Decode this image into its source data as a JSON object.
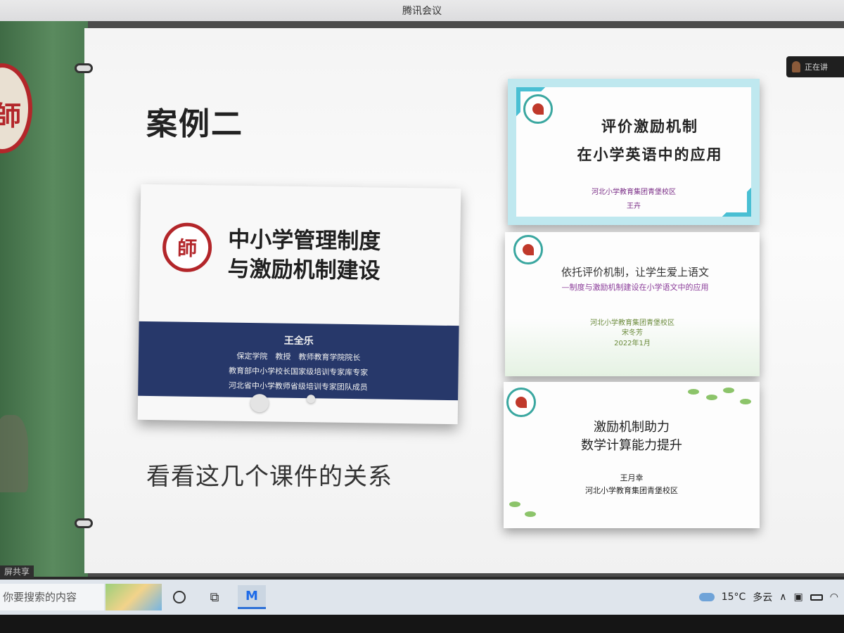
{
  "window": {
    "title": "腾讯会议"
  },
  "presenter": {
    "label": "正在讲"
  },
  "share": {
    "label": "屏共享"
  },
  "left_strip": {
    "seal_char": "師"
  },
  "slide": {
    "title": "案例二",
    "caption": "看看这几个课件的关系",
    "main_card": {
      "logo_char": "師",
      "headline_line1": "中小学管理制度",
      "headline_line2": "与激励机制建设",
      "name": "王全乐",
      "line1": "保定学院　教授　教师教育学院院长",
      "line2": "教育部中小学校长国家级培训专家库专家",
      "line3": "河北省中小学教师省级培训专家团队成员"
    },
    "thumb1": {
      "title_line1": "评价激励机制",
      "title_line2": "在小学英语中的应用",
      "org": "河北小学教育集团青堡校区",
      "person": "王卉"
    },
    "thumb2": {
      "title": "依托评价机制，让学生爱上语文",
      "subtitle": "—制度与激励机制建设在小学语文中的应用",
      "org": "河北小学教育集团青堡校区",
      "person": "宋冬芳",
      "date": "2022年1月"
    },
    "thumb3": {
      "title_line1": "激励机制助力",
      "title_line2": "数学计算能力提升",
      "person": "王月幸",
      "org": "河北小学教育集团青堡校区"
    }
  },
  "taskbar": {
    "search_placeholder": "你要搜索的内容",
    "weather_temp": "15°C",
    "weather_desc": "多云",
    "meeting_icon": "M"
  }
}
